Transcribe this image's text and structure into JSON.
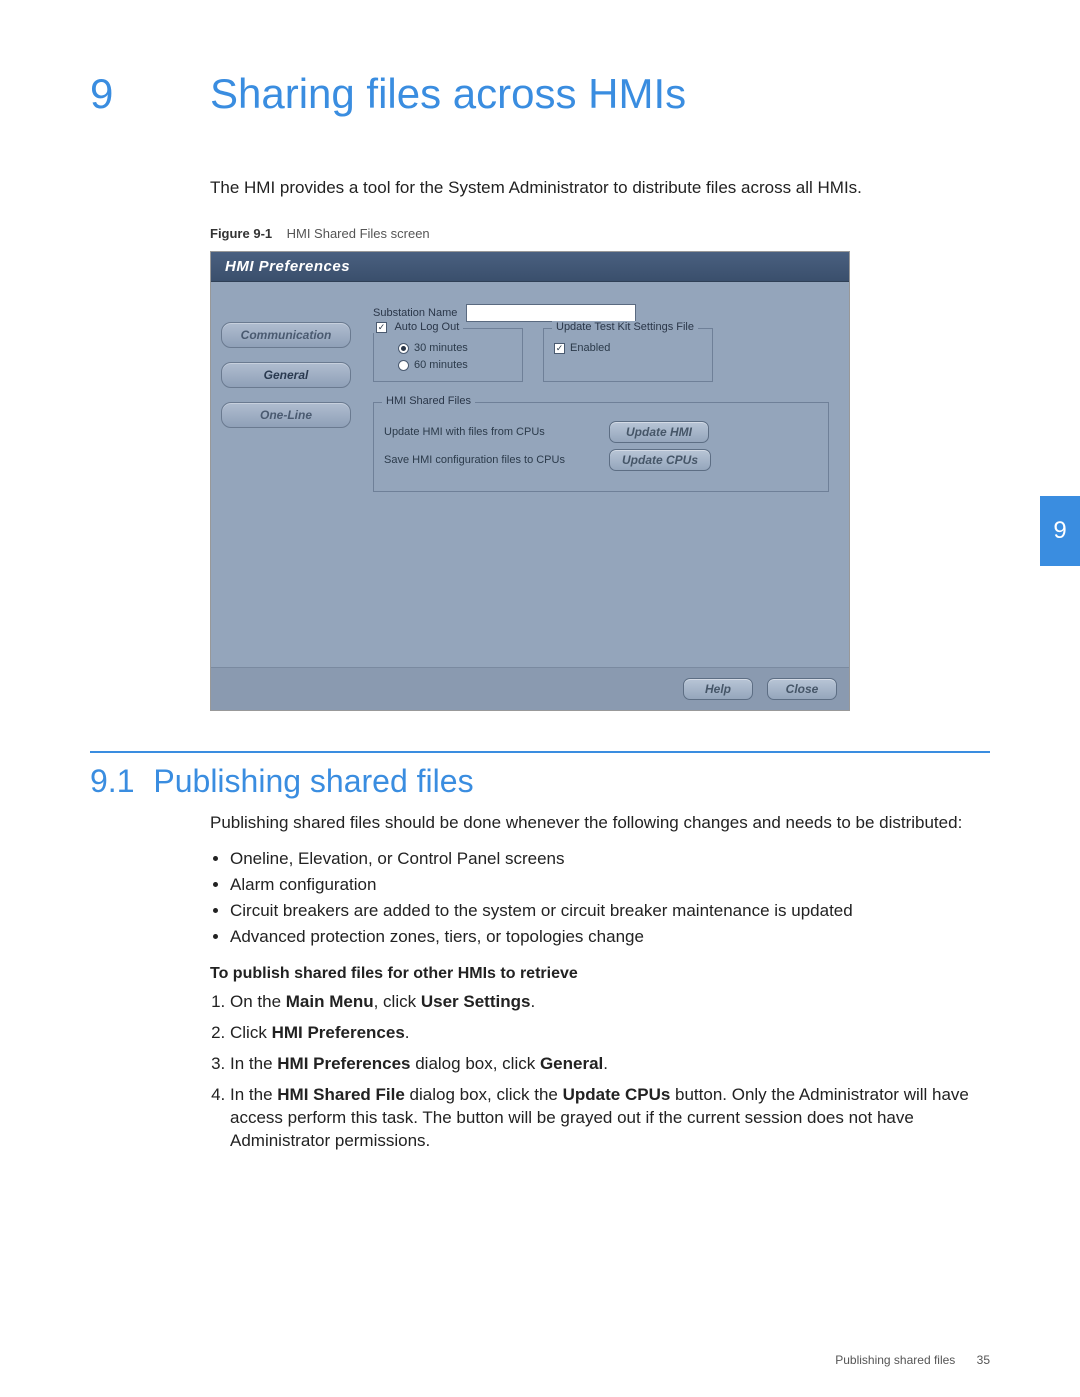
{
  "chapter": {
    "number": "9",
    "title": "Sharing files across HMIs"
  },
  "intro": "The HMI provides a tool for the System Administrator to distribute files across all HMIs.",
  "figure": {
    "label": "Figure 9-1",
    "caption": "HMI Shared Files screen"
  },
  "dialog": {
    "title": "HMI Preferences",
    "tabs": {
      "communication": "Communication",
      "general": "General",
      "oneline": "One-Line"
    },
    "substation_label": "Substation Name",
    "auto_log_out": {
      "label": "Auto Log Out",
      "opt30": "30 minutes",
      "opt60": "60 minutes"
    },
    "update_testkit": {
      "legend": "Update Test Kit Settings File",
      "enabled": "Enabled"
    },
    "shared": {
      "legend": "HMI Shared Files",
      "row1_label": "Update HMI with files from CPUs",
      "row1_button": "Update HMI",
      "row2_label": "Save HMI configuration files to CPUs",
      "row2_button": "Update CPUs"
    },
    "help": "Help",
    "close": "Close"
  },
  "section": {
    "number": "9.1",
    "title": "Publishing shared files"
  },
  "section_intro": "Publishing shared files should be done whenever the following changes and needs to be distributed:",
  "bullets": {
    "b1": "Oneline, Elevation, or Control Panel screens",
    "b2": "Alarm configuration",
    "b3": "Circuit breakers are added to the system or circuit breaker maintenance is updated",
    "b4": "Advanced protection zones, tiers, or topologies change"
  },
  "procedure_title": "To publish shared files for other HMIs to retrieve",
  "steps": {
    "s1_a": "On the ",
    "s1_b": "Main Menu",
    "s1_c": ", click ",
    "s1_d": "User Settings",
    "s1_e": ".",
    "s2_a": "Click ",
    "s2_b": "HMI Preferences",
    "s2_c": ".",
    "s3_a": "In the ",
    "s3_b": "HMI Preferences",
    "s3_c": " dialog box, click ",
    "s3_d": "General",
    "s3_e": ".",
    "s4_a": "In the ",
    "s4_b": "HMI Shared File",
    "s4_c": " dialog box, click the ",
    "s4_d": "Update CPUs",
    "s4_e": " button. Only the Administrator will have access perform this task. The button will be grayed out if the current session does not have Administrator permissions."
  },
  "side_tab": "9",
  "footer": {
    "section": "Publishing shared files",
    "page": "35"
  }
}
